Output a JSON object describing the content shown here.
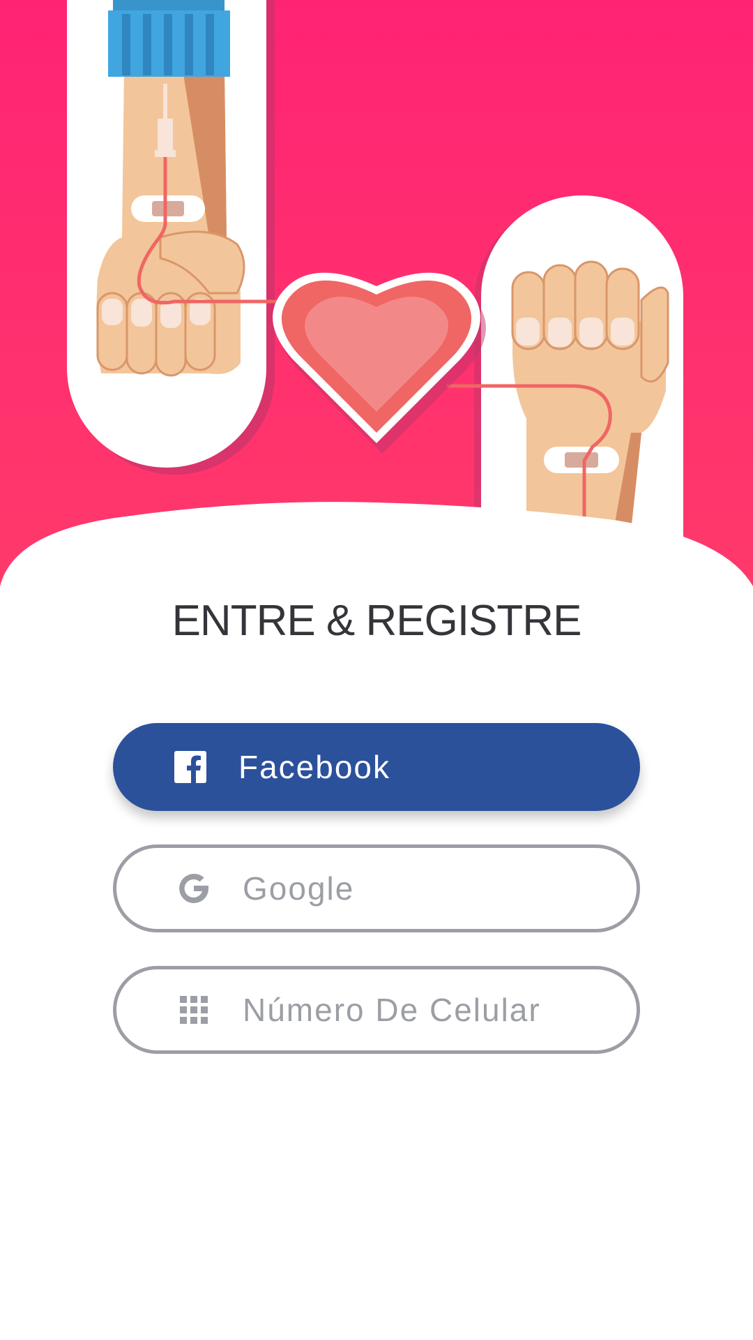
{
  "title": "ENTRE & REGISTRE",
  "buttons": {
    "facebook": {
      "label": "Facebook",
      "icon": "facebook-icon"
    },
    "google": {
      "label": "Google",
      "icon": "google-icon"
    },
    "phone": {
      "label": "Número De Celular",
      "icon": "dialpad-icon"
    }
  },
  "colors": {
    "hero_background": "#ff2a75",
    "facebook_blue": "#2c519b",
    "outline_gray": "#9c9ea5",
    "title_text": "#34353a",
    "heart": "#ef6664"
  }
}
